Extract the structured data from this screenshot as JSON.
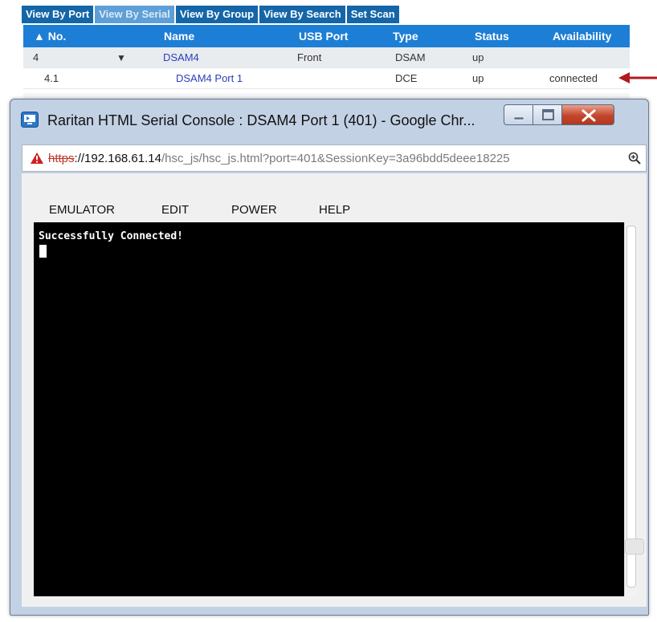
{
  "tabs": [
    {
      "label": "View By Port"
    },
    {
      "label": "View By Serial"
    },
    {
      "label": "View By Group"
    },
    {
      "label": "View By Search"
    },
    {
      "label": "Set Scan"
    }
  ],
  "grid": {
    "headers": {
      "no": "▲ No.",
      "name": "Name",
      "usb_port": "USB Port",
      "type": "Type",
      "status": "Status",
      "availability": "Availability"
    },
    "rows": [
      {
        "no": "4",
        "toggle": "▼",
        "name": "DSAM4",
        "usb_port": "Front",
        "type": "DSAM",
        "status": "up",
        "availability": ""
      },
      {
        "no": "4.1",
        "toggle": "",
        "name": "DSAM4 Port 1",
        "usb_port": "",
        "type": "DCE",
        "status": "up",
        "availability": "connected"
      }
    ]
  },
  "colors": {
    "tab_bg": "#1466a8",
    "tab_active": "#5e9fd7",
    "header_bg": "#1d7ed5",
    "link": "#2b3fb8",
    "annotation_arrow": "#b0191e"
  },
  "window": {
    "title": "Raritan HTML Serial Console : DSAM4 Port 1 (401) - Google Chr...",
    "url": {
      "scheme": "https",
      "host": "://192.168.61.14",
      "path": "/hsc_js/hsc_js.html?port=401&SessionKey=3a96bdd5deee18225"
    },
    "menu": [
      {
        "label": "EMULATOR"
      },
      {
        "label": "EDIT"
      },
      {
        "label": "POWER"
      },
      {
        "label": "HELP"
      }
    ],
    "terminal_output": "Successfully Connected!"
  },
  "icons": [
    "app-icon",
    "minimize-icon",
    "maximize-icon",
    "close-icon",
    "warning-icon",
    "zoom-icon",
    "annotation-arrow-icon"
  ]
}
